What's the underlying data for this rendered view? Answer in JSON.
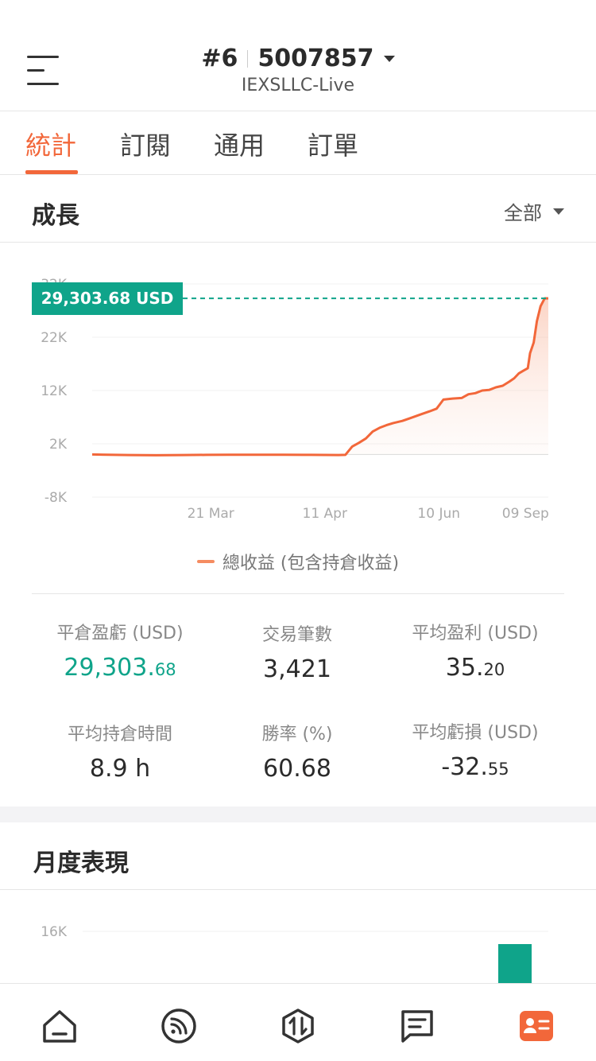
{
  "header": {
    "account_prefix": "#6",
    "account_number": "5007857",
    "server": "IEXSLLC-Live"
  },
  "tabs": [
    {
      "label": "統計",
      "active": true
    },
    {
      "label": "訂閱",
      "active": false
    },
    {
      "label": "通用",
      "active": false
    },
    {
      "label": "訂單",
      "active": false
    }
  ],
  "growth": {
    "title": "成長",
    "filter_label": "全部",
    "current_value_tag": "29,303.68 USD",
    "legend_label": "總收益 (包含持倉收益)"
  },
  "chart_data": {
    "type": "area",
    "y_tick_labels": [
      "32K",
      "22K",
      "12K",
      "2K",
      "-8K"
    ],
    "x_tick_labels": [
      "21 Mar",
      "11 Apr",
      "10 Jun",
      "09 Sep"
    ],
    "ylim": [
      -8000,
      32000
    ],
    "series": [
      {
        "name": "總收益 (包含持倉收益)",
        "color": "#f2673a",
        "points": [
          [
            0,
            0
          ],
          [
            8,
            -100
          ],
          [
            14,
            -150
          ],
          [
            20,
            -100
          ],
          [
            25,
            -80
          ],
          [
            30,
            -60
          ],
          [
            36,
            -50
          ],
          [
            42,
            -60
          ],
          [
            48,
            -80
          ],
          [
            54,
            -100
          ],
          [
            55.5,
            -80
          ],
          [
            57,
            1500
          ],
          [
            58.5,
            2200
          ],
          [
            60,
            3000
          ],
          [
            61.5,
            4300
          ],
          [
            63,
            5000
          ],
          [
            64.5,
            5500
          ],
          [
            66,
            5900
          ],
          [
            68,
            6300
          ],
          [
            70,
            6900
          ],
          [
            72,
            7500
          ],
          [
            74,
            8100
          ],
          [
            75.5,
            8600
          ],
          [
            77,
            10300
          ],
          [
            79,
            10500
          ],
          [
            81,
            10600
          ],
          [
            82.5,
            11300
          ],
          [
            84,
            11500
          ],
          [
            85.5,
            12000
          ],
          [
            87,
            12100
          ],
          [
            88.5,
            12600
          ],
          [
            90,
            12900
          ],
          [
            91.5,
            13700
          ],
          [
            92.5,
            14300
          ],
          [
            93.5,
            15200
          ],
          [
            94.5,
            15700
          ],
          [
            95.5,
            16200
          ],
          [
            96,
            19000
          ],
          [
            96.8,
            21000
          ],
          [
            97.5,
            25000
          ],
          [
            98.3,
            27800
          ],
          [
            99.2,
            29303.68
          ],
          [
            100,
            29303.68
          ]
        ]
      }
    ],
    "current_value": 29303.68,
    "grid": true,
    "reference_line": {
      "value": 29303.68,
      "style": "dashed",
      "color": "#0fa48a"
    }
  },
  "stats": {
    "closed_pnl": {
      "label": "平倉盈虧 (USD)",
      "int": "29,303.",
      "dec": "68"
    },
    "trade_count": {
      "label": "交易筆數",
      "value": "3,421"
    },
    "avg_profit": {
      "label": "平均盈利 (USD)",
      "int": "35.",
      "dec": "20"
    },
    "avg_hold_time": {
      "label": "平均持倉時間",
      "value": "8.9 h"
    },
    "win_rate": {
      "label": "勝率 (%)",
      "value": "60.68"
    },
    "avg_loss": {
      "label": "平均虧損 (USD)",
      "int": "-32.",
      "dec": "55"
    }
  },
  "monthly": {
    "title": "月度表現",
    "y_tick_label": "16K",
    "bar_color": "#0fa48a"
  },
  "colors": {
    "accent": "#f2673a",
    "positive": "#0fa48a"
  },
  "bottom_nav": [
    {
      "icon": "home-icon",
      "active": false
    },
    {
      "icon": "signal-feed-icon",
      "active": false
    },
    {
      "icon": "trade-icon",
      "active": false
    },
    {
      "icon": "document-icon",
      "active": false
    },
    {
      "icon": "profile-card-icon",
      "active": true
    }
  ]
}
